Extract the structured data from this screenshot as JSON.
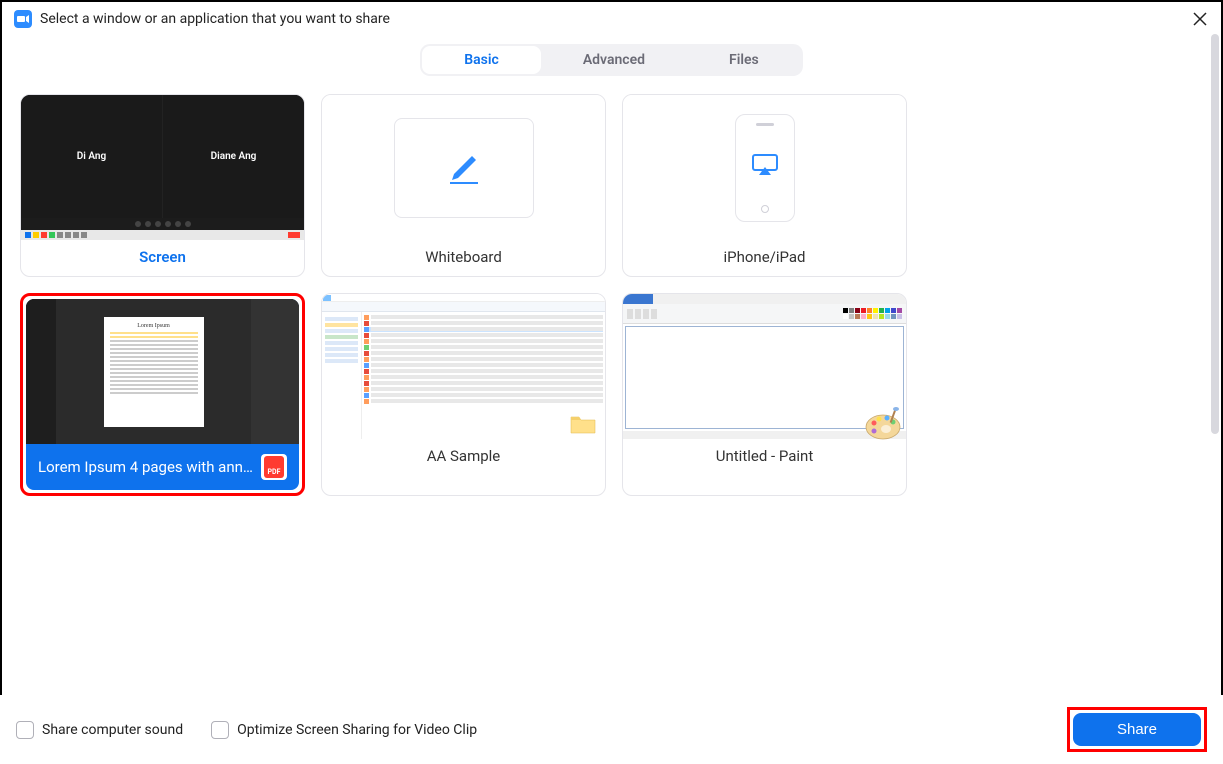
{
  "header": {
    "title": "Select a window or an application that you want to share"
  },
  "tabs": {
    "basic": "Basic",
    "advanced": "Advanced",
    "files": "Files"
  },
  "tiles": {
    "screen": {
      "label": "Screen",
      "participant1": "Di Ang",
      "participant2": "Diane Ang"
    },
    "whiteboard": {
      "label": "Whiteboard"
    },
    "iphone": {
      "label": "iPhone/iPad"
    },
    "pdf": {
      "label": "Lorem Ipsum 4 pages with annot...",
      "doc_title": "Lorem Ipsum",
      "badge": "PDF"
    },
    "explorer": {
      "label": "AA Sample"
    },
    "paint": {
      "label": "Untitled - Paint"
    }
  },
  "footer": {
    "sound": "Share computer sound",
    "optimize": "Optimize Screen Sharing for Video Clip",
    "share": "Share"
  },
  "colors": {
    "accent": "#0e72ed",
    "highlight": "#ff0000"
  }
}
